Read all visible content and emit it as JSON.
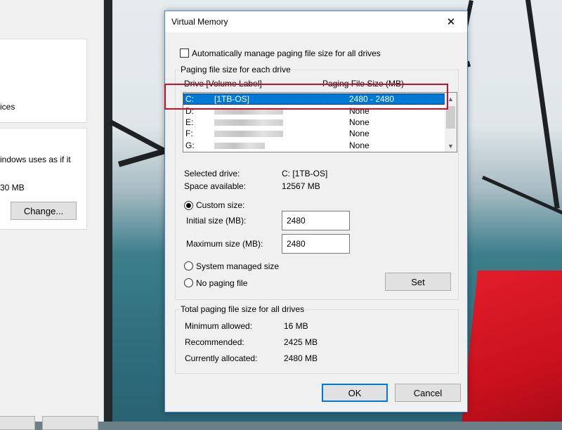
{
  "background_window": {
    "text_1": "ices",
    "text_2": "indows uses as if it",
    "text_3": "30 MB",
    "change_button": "Change..."
  },
  "dialog": {
    "title": "Virtual Memory",
    "close_glyph": "✕",
    "auto_manage": {
      "label": "Automatically manage paging file size for all drives",
      "checked": false
    },
    "paging_group": {
      "legend": "Paging file size for each drive",
      "col_drive": "Drive  [Volume Label]",
      "col_size": "Paging File Size (MB)",
      "drives": [
        {
          "drive": "C:",
          "label": "[1TB-OS]",
          "size": "2480 - 2480",
          "selected": true
        },
        {
          "drive": "D:",
          "label": "",
          "size": "None",
          "selected": false
        },
        {
          "drive": "E:",
          "label": "",
          "size": "None",
          "selected": false
        },
        {
          "drive": "F:",
          "label": "",
          "size": "None",
          "selected": false
        },
        {
          "drive": "G:",
          "label": "",
          "size": "None",
          "selected": false
        }
      ],
      "selected_drive_label": "Selected drive:",
      "selected_drive_value": "C:  [1TB-OS]",
      "space_available_label": "Space available:",
      "space_available_value": "12567 MB",
      "custom_size_label": "Custom size:",
      "initial_size_label": "Initial size (MB):",
      "initial_size_value": "2480",
      "max_size_label": "Maximum size (MB):",
      "max_size_value": "2480",
      "system_managed_label": "System managed size",
      "no_paging_label": "No paging file",
      "selected_option": "custom",
      "set_button": "Set"
    },
    "total_group": {
      "legend": "Total paging file size for all drives",
      "min_label": "Minimum allowed:",
      "min_value": "16 MB",
      "recommended_label": "Recommended:",
      "recommended_value": "2425 MB",
      "allocated_label": "Currently allocated:",
      "allocated_value": "2480 MB"
    },
    "ok_button": "OK",
    "cancel_button": "Cancel"
  },
  "colors": {
    "selection": "#0078d7",
    "highlight_annotation": "#c8102e",
    "dialog_bg": "#f0f0f0"
  }
}
